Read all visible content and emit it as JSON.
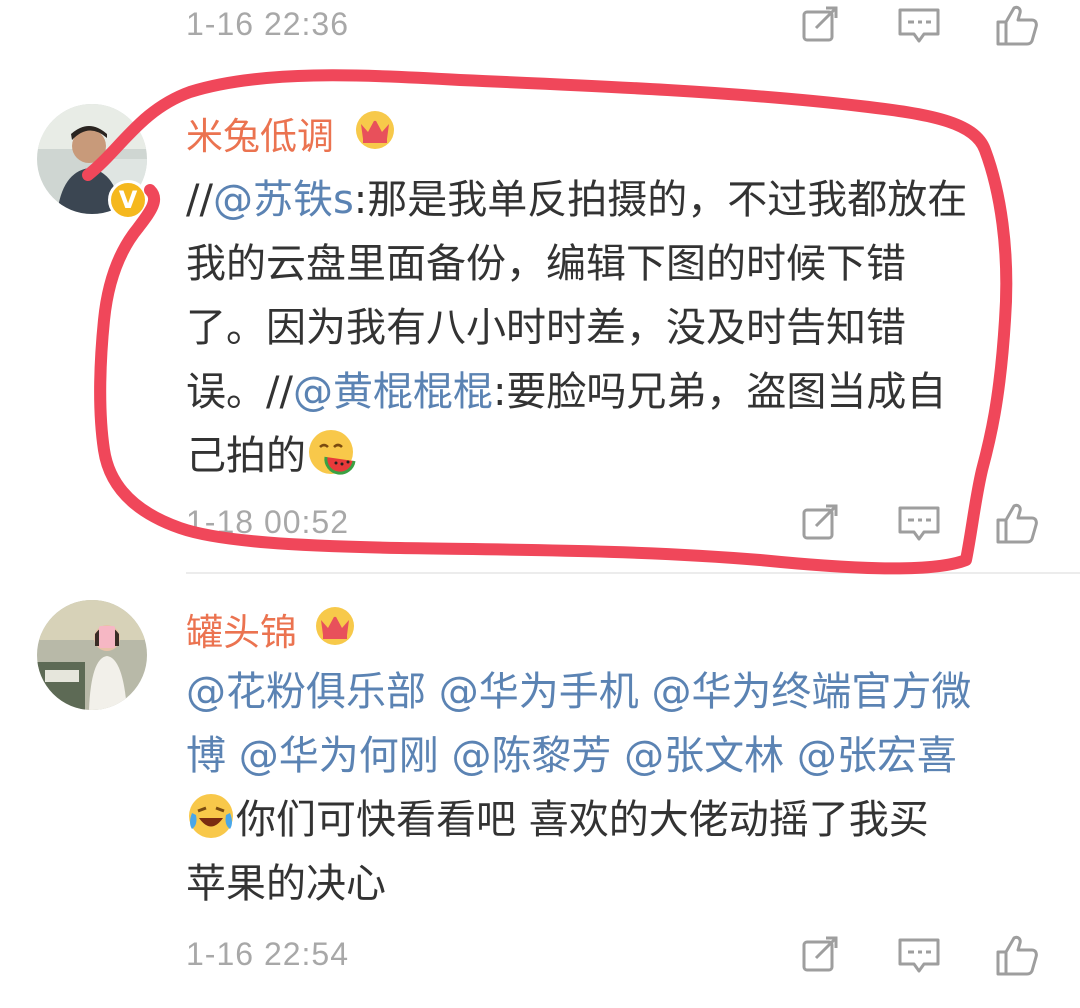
{
  "top_item": {
    "time": "1-16 22:36"
  },
  "comment1": {
    "username": "米兔低调",
    "verified_mark": "V",
    "lines": [
      {
        "a": "//",
        "mention": "@苏铁s",
        "b": ":那是我单反拍摄的，不过我都放在"
      },
      {
        "text": "我的云盘里面备份，编辑下图的时候下错"
      },
      {
        "text": "了。因为我有八小时时差，没及时告知错"
      },
      {
        "a": "误。//",
        "mention": "@黄棍棍棍",
        "b": ":要脸吗兄弟，盗图当成自"
      },
      {
        "text": "己拍的"
      }
    ],
    "emoji": "watermelon-eating-emoji",
    "time": "1-18 00:52"
  },
  "comment2": {
    "username": "罐头锦",
    "line1_mentions": [
      "@花粉俱乐部",
      "@华为手机",
      "@华为终端官方微"
    ],
    "line2_mentions": [
      "博",
      "@华为何刚",
      "@陈黎芳",
      "@张文林",
      "@张宏喜"
    ],
    "line3_text": "你们可快看看吧  喜欢的大佬动摇了我买",
    "line4_text": "苹果的决心",
    "emoji": "laughing-crying-emoji",
    "time": "1-16 22:54"
  },
  "icons": {
    "repost": "repost-icon",
    "comment": "comment-icon",
    "like": "like-icon"
  },
  "colors": {
    "username": "#eb7350",
    "mention": "#5b83b3",
    "text": "#333333",
    "time": "#a8a8a8",
    "highlight_stroke": "#f0475a",
    "badge": "#f5b81e",
    "crown": "#f0a23a"
  }
}
